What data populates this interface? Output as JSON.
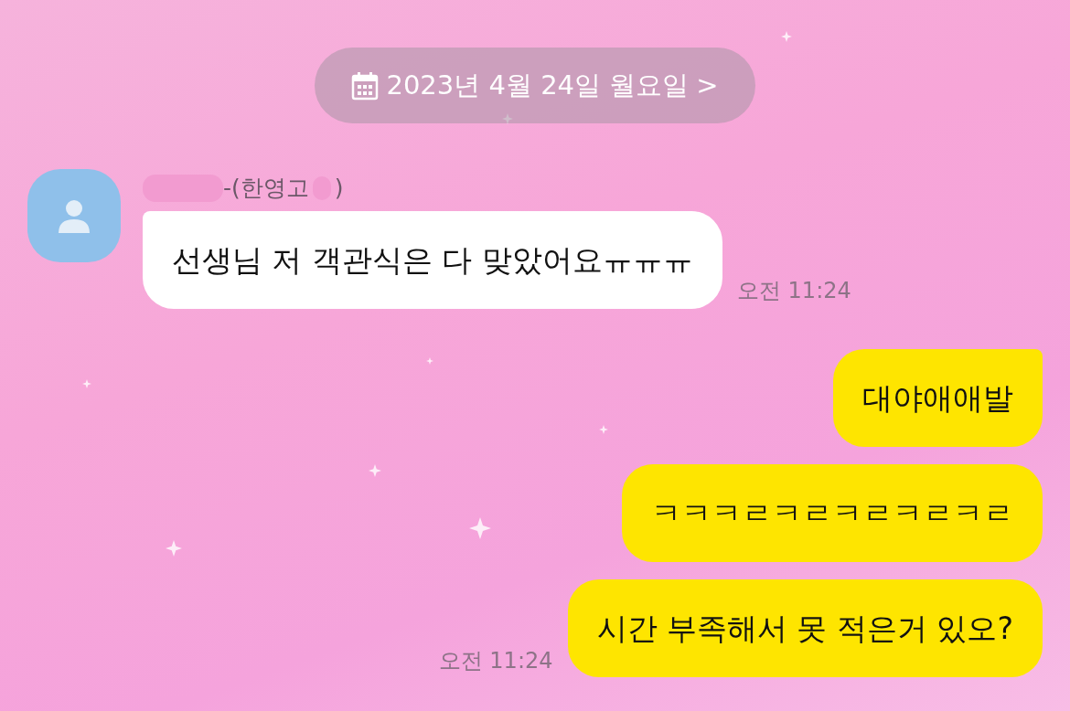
{
  "date_banner": {
    "text": "2023년 4월 24일 월요일",
    "chevron": ">"
  },
  "messages": [
    {
      "kind": "received",
      "sender_parts": [
        "-(한영고",
        ")"
      ],
      "text": "선생님 저 객관식은 다 맞았어요ㅠㅠㅠ",
      "time": "오전 11:24"
    },
    {
      "kind": "sent",
      "text": "대야애애발"
    },
    {
      "kind": "sent",
      "text": "ㅋㅋㅋㄹㅋㄹㅋㄹㅋㄹㅋㄹ"
    },
    {
      "kind": "sent",
      "text": "시간 부족해서 못 적은거 있오?",
      "time": "오전 11:24"
    }
  ]
}
